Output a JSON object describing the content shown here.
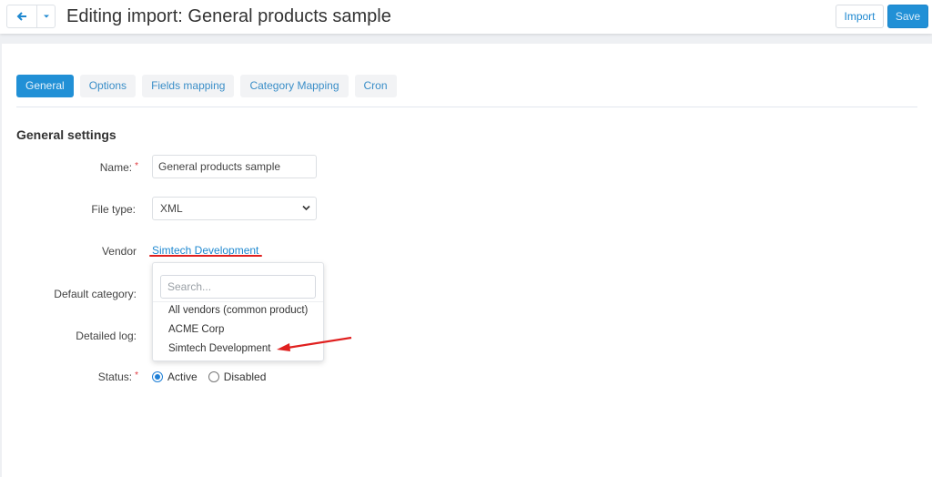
{
  "header": {
    "title": "Editing import: General products sample",
    "back_icon": "arrow-left-icon",
    "menu_icon": "caret-down-icon",
    "import_label": "Import",
    "save_label": "Save"
  },
  "tabs": [
    {
      "label": "General",
      "active": true
    },
    {
      "label": "Options",
      "active": false
    },
    {
      "label": "Fields mapping",
      "active": false
    },
    {
      "label": "Category Mapping",
      "active": false
    },
    {
      "label": "Cron",
      "active": false
    }
  ],
  "section": {
    "title": "General settings"
  },
  "form": {
    "name_label": "Name:",
    "name_required": "*",
    "name_value": "General products sample",
    "file_type_label": "File type:",
    "file_type_value": "XML",
    "vendor_label": "Vendor",
    "vendor_value": "Simtech Development",
    "default_category_label": "Default category:",
    "detailed_log_label": "Detailed log:",
    "status_label": "Status:",
    "status_required": "*",
    "status_options": [
      {
        "label": "Active",
        "checked": true
      },
      {
        "label": "Disabled",
        "checked": false
      }
    ]
  },
  "vendor_dropdown": {
    "search_placeholder": "Search...",
    "items": [
      "All vendors (common product)",
      "ACME Corp",
      "Simtech Development"
    ]
  },
  "colors": {
    "accent": "#2190d6",
    "annotation_red": "#e0201f"
  }
}
